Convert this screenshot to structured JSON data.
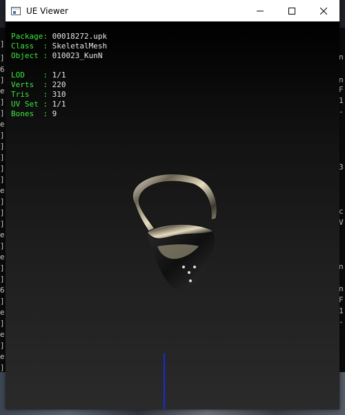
{
  "window": {
    "title": "UE Viewer",
    "controls": {
      "minimize": "—",
      "maximize": "☐",
      "close": "✕"
    }
  },
  "info_top": [
    {
      "key": "Package:",
      "value": "00018272.upk"
    },
    {
      "key": "Class  :",
      "value": "SkeletalMesh"
    },
    {
      "key": "Object :",
      "value": "010023_KunN"
    }
  ],
  "info_bottom": [
    {
      "key": "LOD    :",
      "value": "1/1"
    },
    {
      "key": "Verts  :",
      "value": "220"
    },
    {
      "key": "Tris   :",
      "value": "310"
    },
    {
      "key": "UV Set :",
      "value": "1/1"
    },
    {
      "key": "Bones  :",
      "value": "9"
    }
  ],
  "background_console": {
    "left_chars": [
      "]",
      "]",
      "6",
      "]",
      "e",
      "]",
      "]",
      "e",
      "]",
      "]",
      "]",
      "]",
      "]",
      "e",
      "]",
      "]",
      "]",
      "e",
      "]",
      "e",
      "]",
      "]",
      "6",
      "]",
      "e",
      "]",
      "e",
      "]",
      "e",
      "]",
      "]",
      "]"
    ],
    "right_chars": [
      "n",
      "n",
      "F",
      "1",
      "-",
      "3",
      "c",
      "V",
      "n",
      "n",
      "F",
      "1",
      "-"
    ]
  },
  "colors": {
    "label": "#3ee63e",
    "value": "#e8e8e8",
    "axis": "#1a2bd8"
  }
}
